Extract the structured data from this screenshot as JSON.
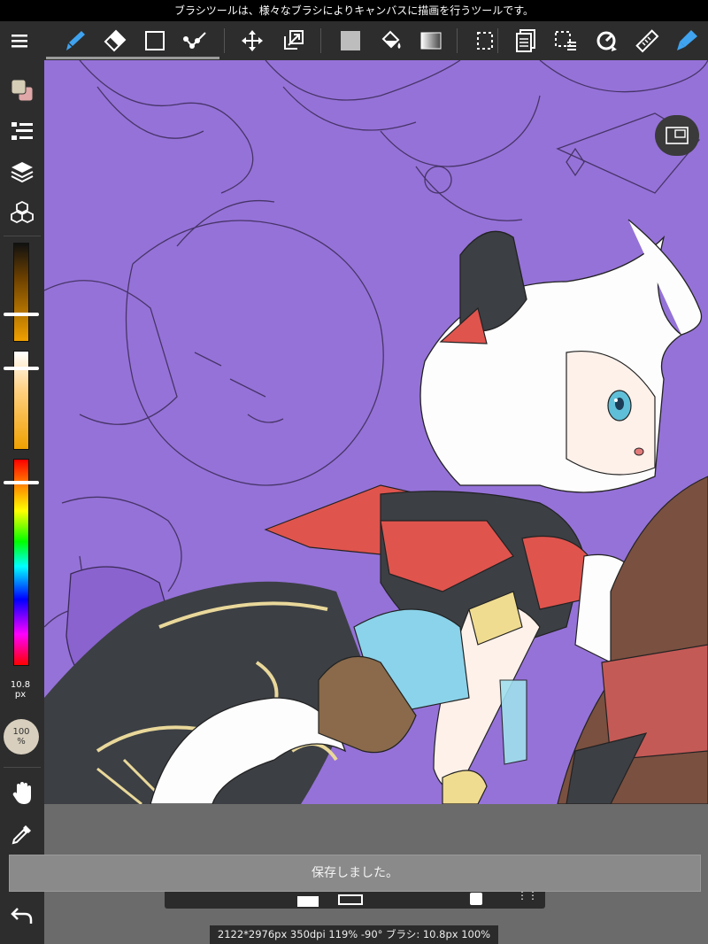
{
  "hint": "ブラシツールは、様々なブラシによりキャンバスに描画を行うツールです。",
  "toolbar": {
    "tools": [
      "menu-icon",
      "brush-icon",
      "eraser-icon",
      "shape-icon",
      "lasso-icon",
      "move-icon",
      "transform-icon",
      "fill-color-icon",
      "bucket-icon",
      "gradient-icon",
      "select-icon",
      "layer-copy-icon",
      "select-edit-icon",
      "rotate-icon",
      "ruler-icon",
      "pen-icon"
    ]
  },
  "left_panel": {
    "brush_size_value": "10.8",
    "brush_size_unit": "px",
    "opacity_value": "100",
    "opacity_unit": "%"
  },
  "colors": {
    "canvas_bg": "#9572d8",
    "brush_accent": "#3fa3f0",
    "primary_color": "#e0a8a8",
    "secondary_color": "#d6cdb6"
  },
  "toast": "保存しました。",
  "status": "2122*2976px 350dpi 119% -90° ブラシ: 10.8px 100%"
}
